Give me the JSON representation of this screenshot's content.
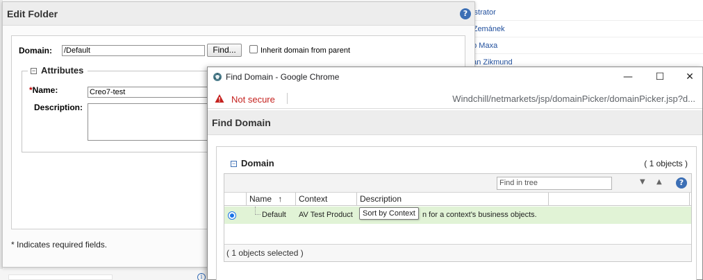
{
  "background": {
    "list_items": [
      "nistrator",
      "r Zemánek",
      "ub Maxa",
      "nan Zikmund"
    ],
    "info_glyph": "i"
  },
  "edit_folder": {
    "title": "Edit Folder",
    "help_glyph": "?",
    "domain_label": "Domain:",
    "domain_value": "/Default",
    "find_button": "Find...",
    "inherit_label": "Inherit domain from parent",
    "attributes_legend": "Attributes",
    "collapse_glyph": "−",
    "required_star": "*",
    "name_label": "Name:",
    "name_value": "Creo7-test",
    "description_label": "Description:",
    "required_note": "* Indicates required fields."
  },
  "chrome": {
    "window_title": "Find Domain - Google Chrome",
    "minimize_glyph": "—",
    "maximize_glyph": "☐",
    "close_glyph": "✕",
    "not_secure": "Not secure",
    "url": "Windchill/netmarkets/jsp/domainPicker/domainPicker.jsp?d..."
  },
  "find_domain": {
    "page_title": "Find Domain",
    "panel_title": "Domain",
    "collapse_glyph": "−",
    "count": "( 1 objects )",
    "find_placeholder": "Find in tree",
    "sort_down_glyph": "▼",
    "sort_up_glyph": "▲",
    "help_glyph": "?",
    "columns": {
      "name": "Name",
      "name_sort": "↑",
      "context": "Context",
      "description": "Description"
    },
    "row": {
      "name": "Default",
      "context": "AV Test Product",
      "description": "n for a context's business objects."
    },
    "tooltip": "Sort by Context",
    "footer": "( 1 objects selected )"
  }
}
